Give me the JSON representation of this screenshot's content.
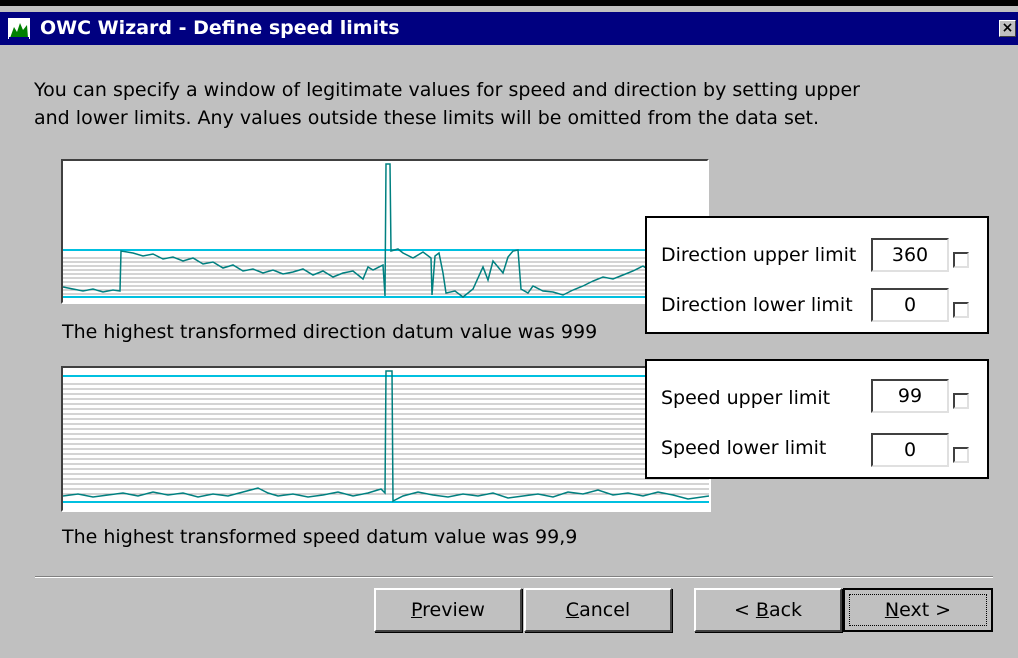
{
  "window": {
    "title": "OWC Wizard - Define speed limits",
    "close_glyph": "×"
  },
  "intro": {
    "line1": "You can specify a window of legitimate values for speed and direction by setting upper",
    "line2": "and lower limits. Any values outside these limits will be omitted from the data set."
  },
  "direction": {
    "caption": "The highest transformed direction datum value was 999",
    "upper_label": "Direction upper limit",
    "upper_value": "360",
    "lower_label": "Direction lower limit",
    "lower_value": "0"
  },
  "speed": {
    "caption": "The highest transformed speed datum value was 99,9",
    "upper_label": "Speed upper limit",
    "upper_value": "99",
    "lower_label": "Speed lower limit",
    "lower_value": "0"
  },
  "buttons": {
    "preview_u": "P",
    "preview_rest": "review",
    "cancel_u": "C",
    "cancel_rest": "ancel",
    "back_pre": "< ",
    "back_u": "B",
    "back_rest": "ack",
    "next_u": "N",
    "next_rest": "ext >"
  },
  "colors": {
    "titlebar": "#000080",
    "trace": "#008080",
    "limit_line": "#00c0e0",
    "grid": "#a0a0a0"
  },
  "icons": {
    "app": "chart-icon",
    "close": "close-icon"
  }
}
